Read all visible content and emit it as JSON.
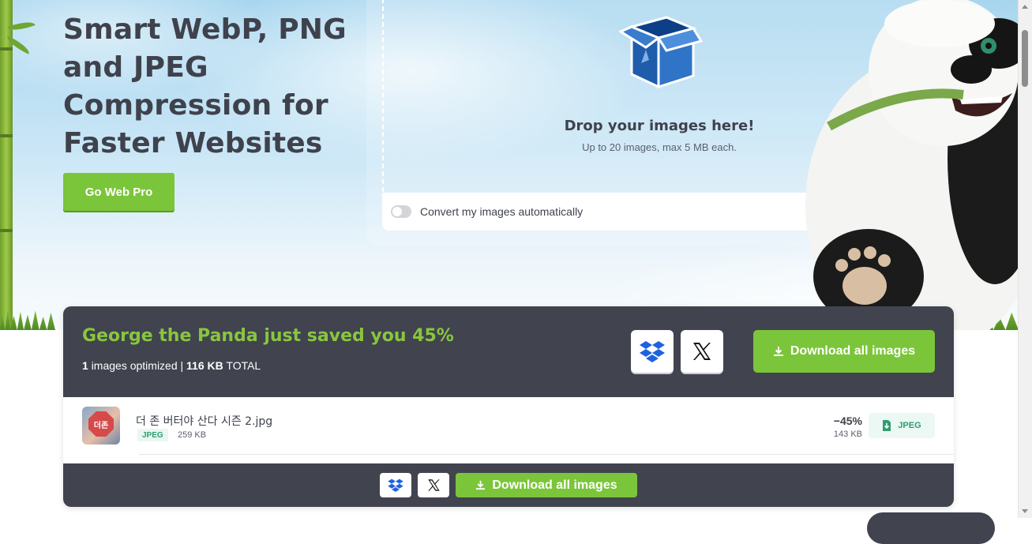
{
  "hero": {
    "headline": "Smart WebP, PNG and JPEG Compression for Faster Websites",
    "pro_button": "Go Web Pro"
  },
  "upload": {
    "drop_title": "Drop your images here!",
    "drop_subtitle": "Up to 20 images, max 5 MB each.",
    "toggle_label": "Convert my images automatically",
    "toggle_on": false
  },
  "results": {
    "title": "George the Panda just saved you 45%",
    "count": "1",
    "count_label": "images optimized",
    "separator": "|",
    "total_size": "116 KB",
    "total_label": "TOTAL",
    "download_all": "Download all images",
    "files": [
      {
        "name": "더 존 버터야 산다 시즌 2.jpg",
        "type": "JPEG",
        "original_size": "259 KB",
        "saving": "−45%",
        "new_size": "143 KB",
        "download_label": "JPEG",
        "thumb_text": "더존"
      }
    ],
    "footer_download_all": "Download all images"
  },
  "colors": {
    "accent_green": "#7bc53a",
    "dark_panel": "#41434e",
    "text_dark": "#3f424c",
    "badge_green": "#2f9e6f"
  },
  "icons": {
    "upload": "box-icon",
    "dropbox": "dropbox-icon",
    "x": "x-logo-icon",
    "download": "download-icon"
  }
}
